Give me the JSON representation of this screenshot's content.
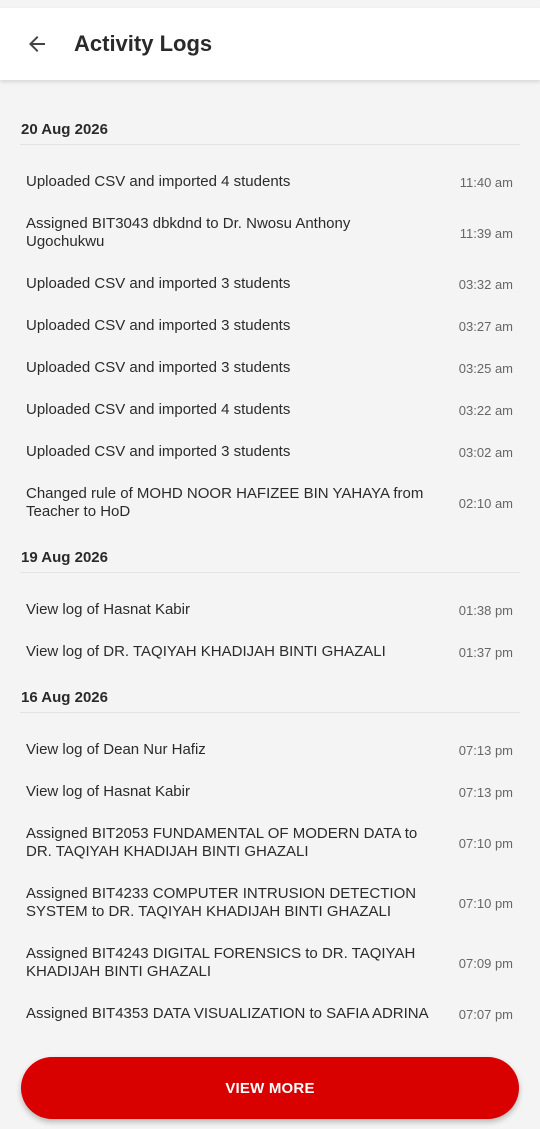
{
  "header": {
    "title": "Activity Logs",
    "back_icon": "arrow-left-icon"
  },
  "groups": [
    {
      "date": "20 Aug 2026",
      "entries": [
        {
          "text": "Uploaded CSV and imported 4 students",
          "time": "11:40 am"
        },
        {
          "text": "Assigned BIT3043 dbkdnd to Dr. Nwosu Anthony Ugochukwu",
          "time": "11:39 am"
        },
        {
          "text": "Uploaded CSV and imported 3 students",
          "time": "03:32 am"
        },
        {
          "text": "Uploaded CSV and imported 3 students",
          "time": "03:27 am"
        },
        {
          "text": "Uploaded CSV and imported 3 students",
          "time": "03:25 am"
        },
        {
          "text": "Uploaded CSV and imported 4 students",
          "time": "03:22 am"
        },
        {
          "text": "Uploaded CSV and imported 3 students",
          "time": "03:02 am"
        },
        {
          "text": "Changed rule of MOHD NOOR HAFIZEE BIN YAHAYA from Teacher to HoD",
          "time": "02:10 am"
        }
      ]
    },
    {
      "date": "19 Aug 2026",
      "entries": [
        {
          "text": "View log of Hasnat Kabir",
          "time": "01:38 pm"
        },
        {
          "text": "View log of DR. TAQIYAH KHADIJAH BINTI GHAZALI",
          "time": "01:37 pm"
        }
      ]
    },
    {
      "date": "16 Aug 2026",
      "entries": [
        {
          "text": "View log of Dean Nur Hafiz",
          "time": "07:13 pm"
        },
        {
          "text": "View log of Hasnat Kabir",
          "time": "07:13 pm"
        },
        {
          "text": "Assigned BIT2053 FUNDAMENTAL OF MODERN DATA to DR. TAQIYAH KHADIJAH BINTI GHAZALI",
          "time": "07:10 pm"
        },
        {
          "text": "Assigned BIT4233 COMPUTER INTRUSION DETECTION SYSTEM to DR. TAQIYAH KHADIJAH BINTI GHAZALI",
          "time": "07:10 pm"
        },
        {
          "text": "Assigned BIT4243 DIGITAL FORENSICS to DR. TAQIYAH KHADIJAH BINTI GHAZALI",
          "time": "07:09 pm"
        },
        {
          "text": "Assigned BIT4353 DATA VISUALIZATION to SAFIA ADRINA",
          "time": "07:07 pm"
        }
      ]
    }
  ],
  "footer": {
    "view_more_label": "VIEW MORE"
  },
  "colors": {
    "accent": "#d90000",
    "background": "#f4f4f4",
    "header_bg": "#ffffff"
  }
}
